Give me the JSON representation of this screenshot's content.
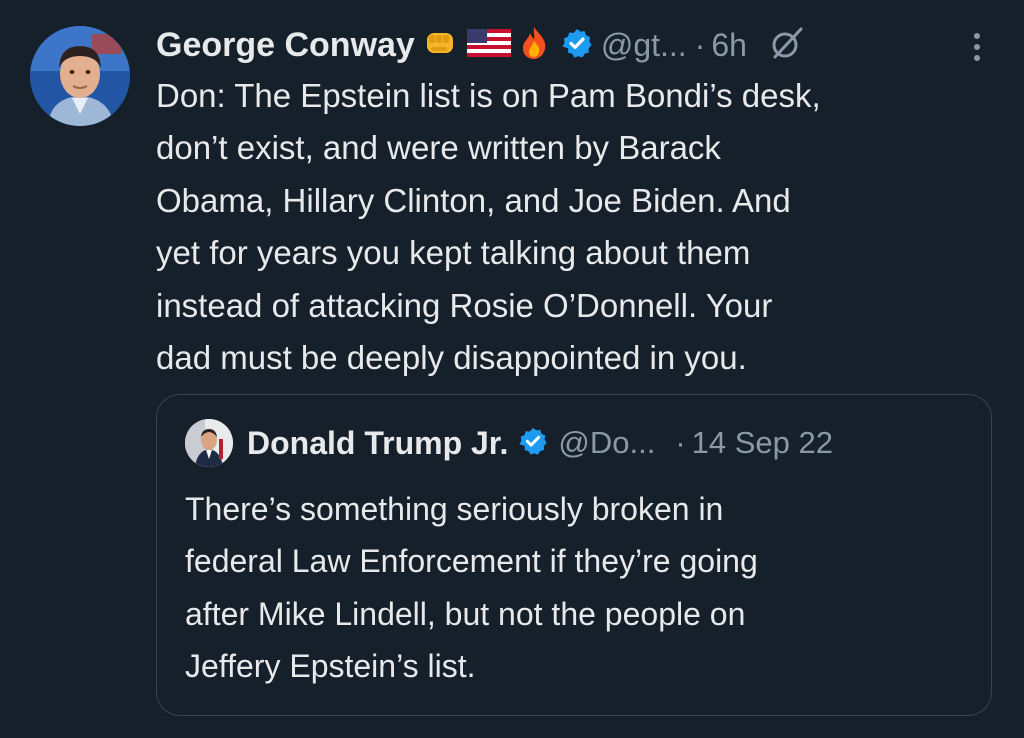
{
  "tweet": {
    "author_name": "George Conway",
    "emojis": [
      "oncoming-fist",
      "us-flag",
      "fire"
    ],
    "verified_icon": "verified-badge",
    "handle": "@gt...",
    "separator": "·",
    "time": "6h",
    "text": "Don:  The Epstein list is on Pam Bondi’s desk,\ndon’t exist, and were written by Barack\nObama, Hillary Clinton, and Joe Biden.  And\nyet for years you kept talking about them\ninstead of attacking Rosie O’Donnell.  Your\ndad must be deeply disappointed in you."
  },
  "quote": {
    "author_name": "Donald Trump Jr.",
    "handle": "@Do...",
    "separator": "·",
    "date": "14 Sep 22",
    "text": "There’s something seriously broken in\nfederal Law Enforcement if they’re going\nafter Mike Lindell, but not the people on\nJeffery Epstein’s list."
  },
  "colors": {
    "background": "#15202b",
    "text": "#e7e9ea",
    "secondary": "#8b98a5",
    "verified": "#1d9bf0",
    "border": "#38444d"
  }
}
